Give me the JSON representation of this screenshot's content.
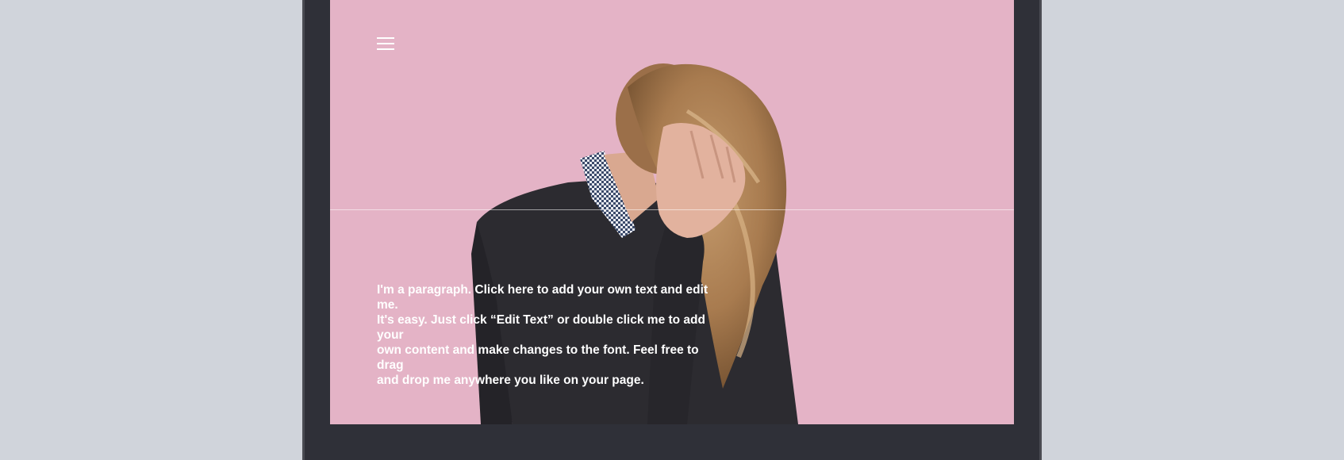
{
  "menu": {
    "icon": "hamburger-menu-icon"
  },
  "hero": {
    "background_color": "#e4b3c6",
    "image": "person-holding-hair-photo"
  },
  "paragraph": {
    "line1": "I'm a paragraph. Click here to add your own text and edit me.",
    "line2": "It's easy. Just click “Edit Text” or double click me to add your",
    "line3": "own content and make changes to the font. Feel free to drag",
    "line4": "and drop me anywhere you like on your page."
  }
}
